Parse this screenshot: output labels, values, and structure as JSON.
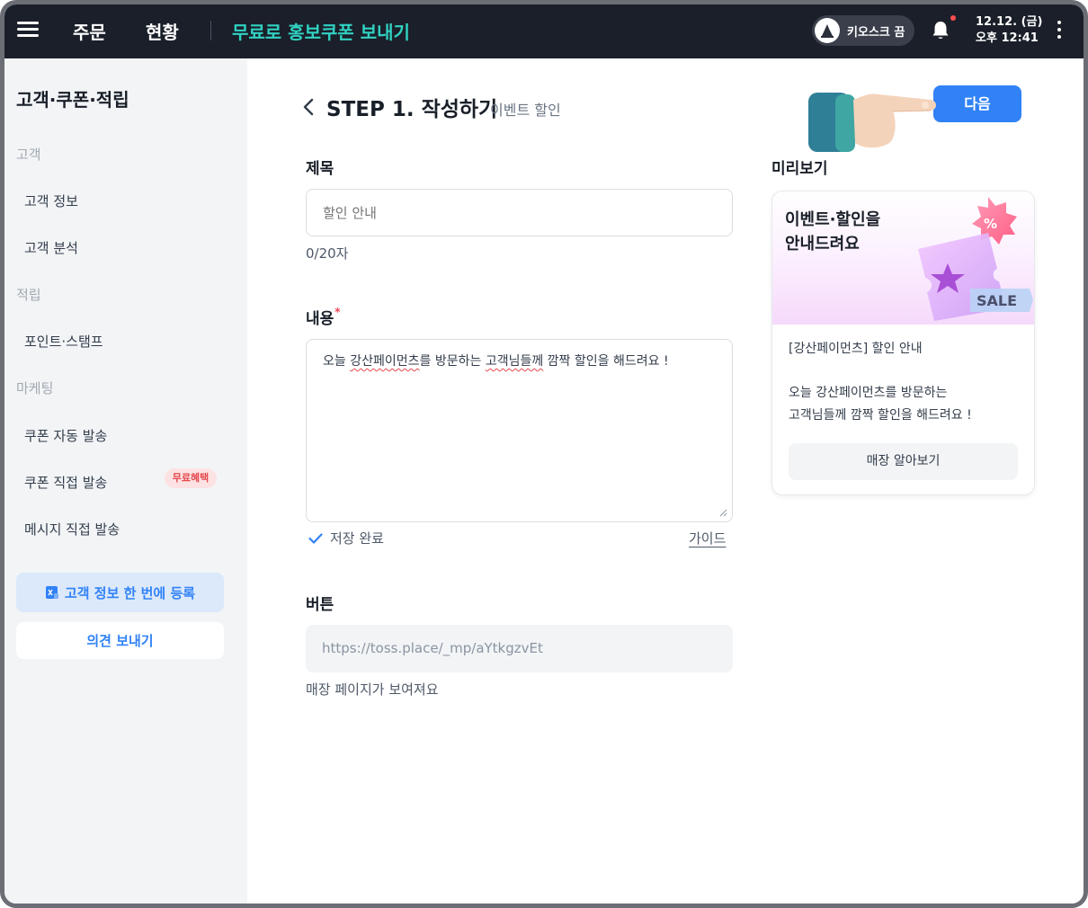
{
  "topbar": {
    "menu_icon": "hamburger-menu-icon",
    "nav": [
      "주문",
      "현황"
    ],
    "current_page": "무료로 홍보쿠폰 보내기",
    "kiosk_label": "키오스크 끔",
    "clock_date": "12.12. (금)",
    "clock_time": "오후 12:41"
  },
  "sidebar": {
    "title": "고객·쿠폰·적립",
    "groups": [
      {
        "label": "고객",
        "items": [
          "고객 정보",
          "고객 분석"
        ]
      },
      {
        "label": "적립",
        "items": [
          "포인트·스탬프"
        ]
      },
      {
        "label": "마케팅",
        "items": [
          "쿠폰 자동 발송",
          "쿠폰 직접 발송",
          "메시지 직접 발송"
        ]
      }
    ],
    "badge": "무료혜택",
    "register_button": "고객 정보 한 번에 등록",
    "feedback_button": "의견 보내기"
  },
  "header": {
    "step_title": "STEP 1. 작성하기",
    "step_subtitle": "이벤트 할인",
    "next_button": "다음"
  },
  "form": {
    "title_label": "제목",
    "title_placeholder": "할인 안내",
    "title_counter": "0/20자",
    "content_label": "내용",
    "content_required_mark": "*",
    "content_text_parts": [
      "오늘 ",
      "강산페이먼츠",
      "를 방문하는 ",
      "고객님들께",
      " 깜짝 할인을 해드려요 !"
    ],
    "saved_status": "저장 완료",
    "guide_link": "가이드",
    "button_label": "버튼",
    "button_url": "https://toss.place/_mp/aYtkgzvEt",
    "button_help": "매장 페이지가 보여져요"
  },
  "preview": {
    "label": "미리보기",
    "headline_line1": "이벤트·할인을",
    "headline_line2": "안내드려요",
    "sale_tag": "SALE",
    "percent_tag": "%",
    "body_title": "[강산페이먼츠] 할인 안내",
    "body_line1": "오늘 강산페이먼츠를 방문하는",
    "body_line2": "고객님들께 깜짝 할인을 해드려요 !",
    "store_button": "매장 알아보기"
  },
  "colors": {
    "topbar_bg": "#1a1f29",
    "accent_teal": "#31d1c2",
    "primary_blue": "#3182f6",
    "sidebar_bg": "#f2f4f6",
    "badge_red": "#e5484d"
  }
}
